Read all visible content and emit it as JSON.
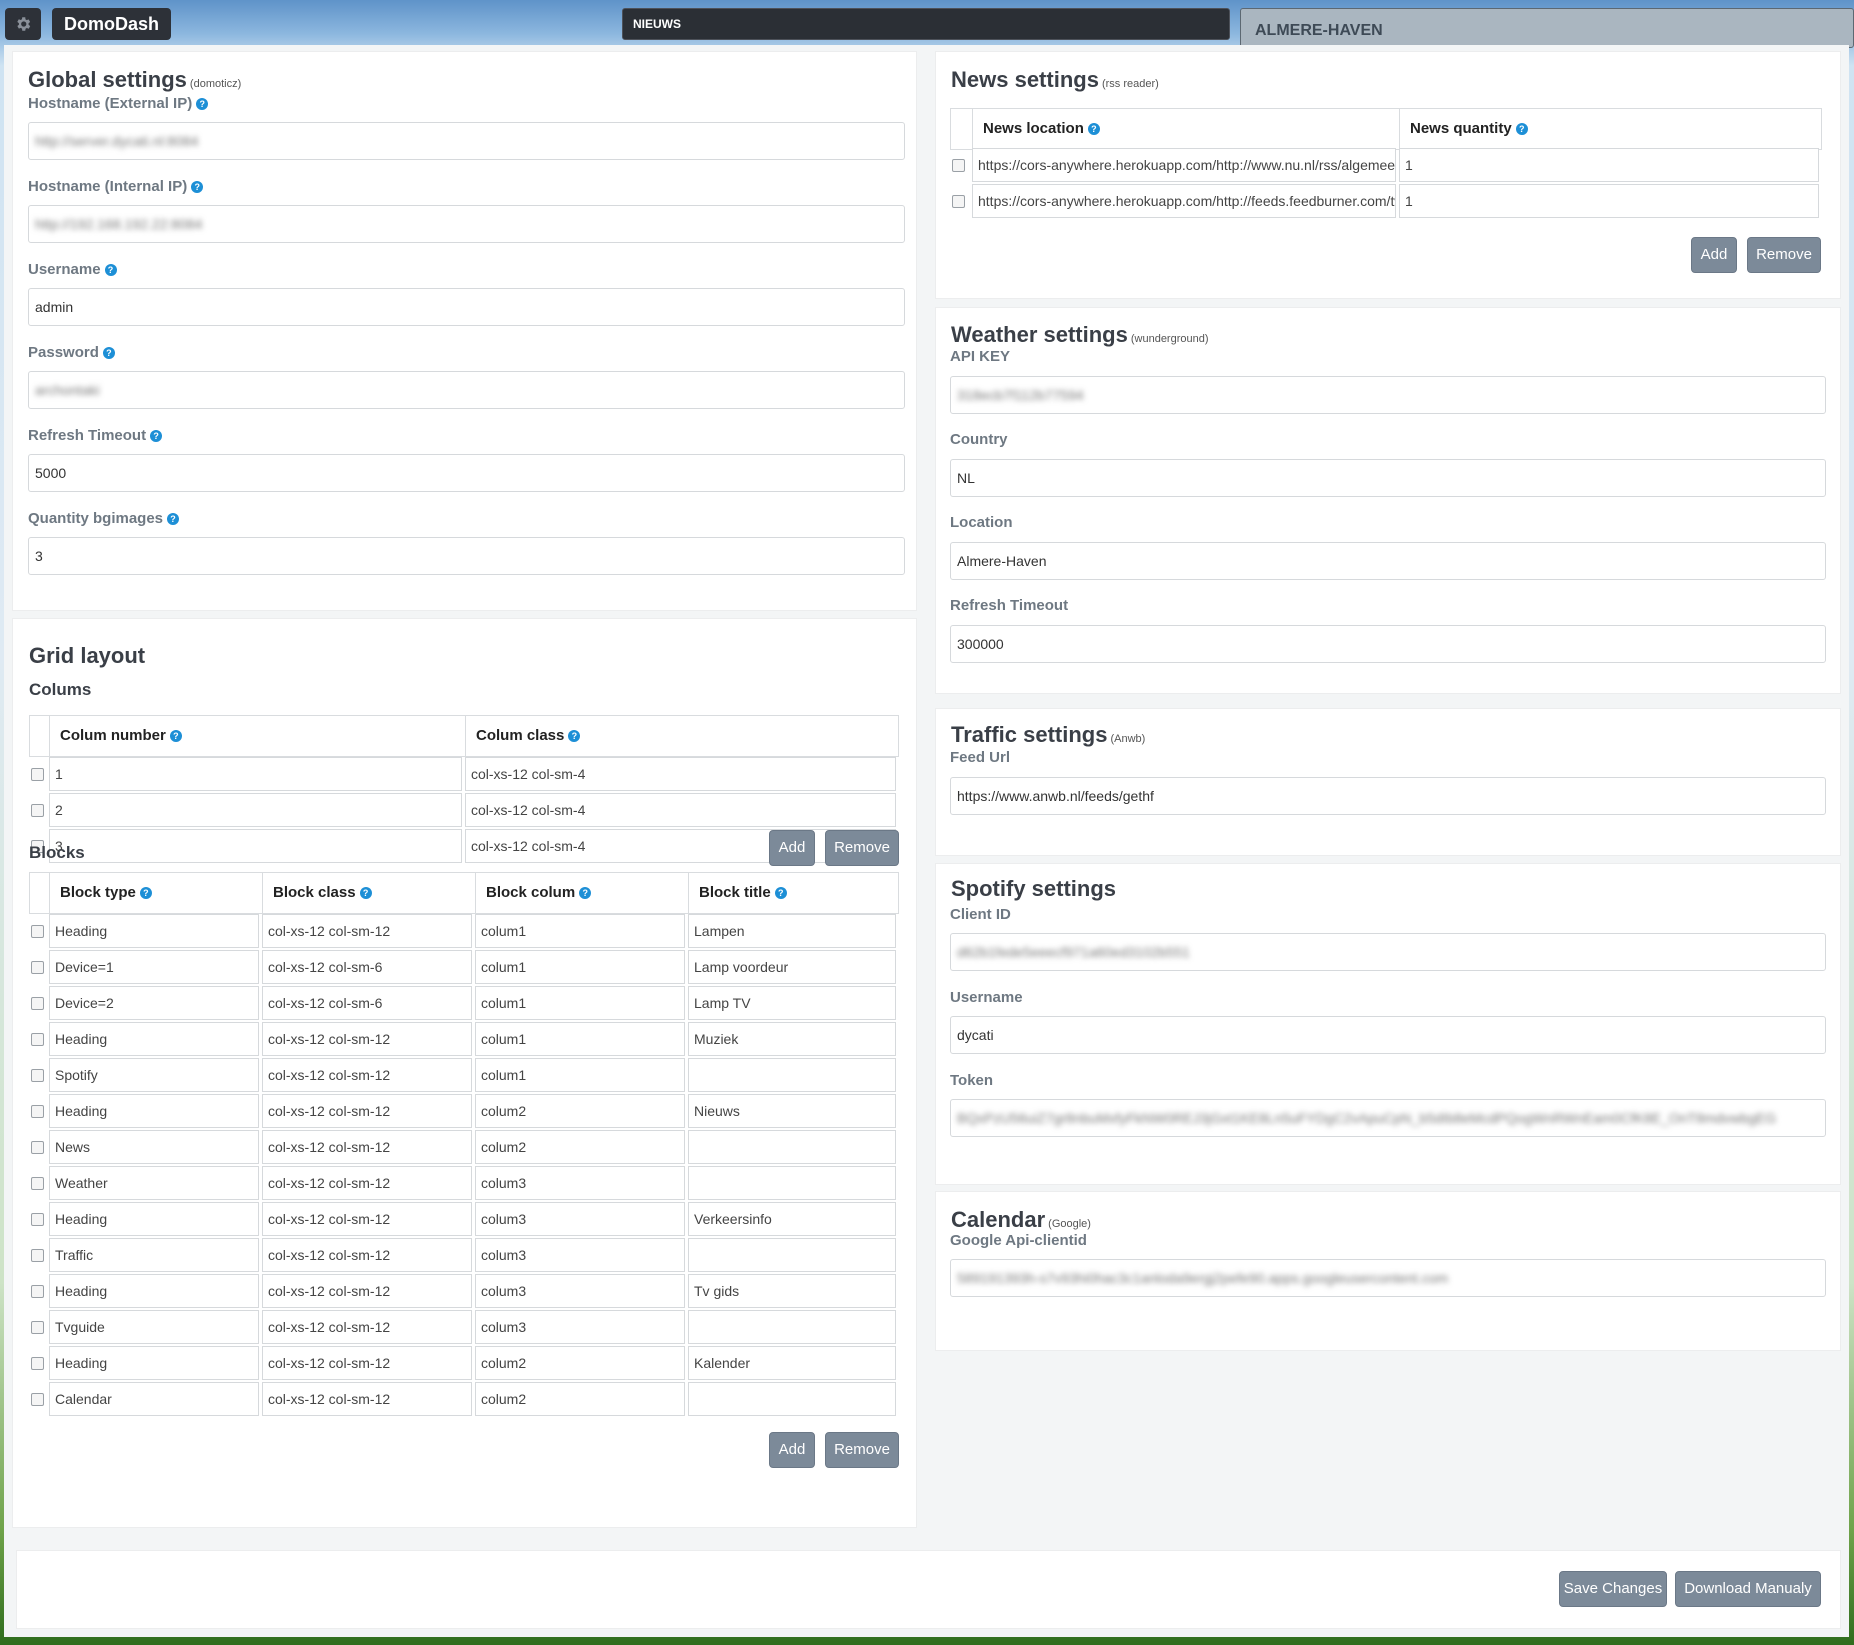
{
  "topbar": {
    "brand": "DomoDash",
    "news_label": "NIEUWS",
    "location": "ALMERE-HAVEN"
  },
  "global": {
    "title": "Global settings",
    "subtitle": "(domoticz)",
    "fields": [
      {
        "label": "Hostname (External IP)",
        "value": "http://server.dycati.nl:8084",
        "blurred": true
      },
      {
        "label": "Hostname (Internal IP)",
        "value": "http://192.168.192.22:8084",
        "blurred": true
      },
      {
        "label": "Username",
        "value": "admin"
      },
      {
        "label": "Password",
        "value": "archontaki",
        "blurred": true
      },
      {
        "label": "Refresh Timeout",
        "value": "5000"
      },
      {
        "label": "Quantity bgimages",
        "value": "3"
      }
    ]
  },
  "grid": {
    "title": "Grid layout",
    "colums_label": "Colums",
    "col_headers": [
      "Colum number",
      "Colum class"
    ],
    "columns": [
      [
        "1",
        "col-xs-12 col-sm-4"
      ],
      [
        "2",
        "col-xs-12 col-sm-4"
      ],
      [
        "3",
        "col-xs-12 col-sm-4"
      ]
    ],
    "blocks_label": "Blocks",
    "block_headers": [
      "Block type",
      "Block class",
      "Block colum",
      "Block title"
    ],
    "blocks": [
      [
        "Heading",
        "col-xs-12 col-sm-12",
        "colum1",
        "Lampen"
      ],
      [
        "Device=1",
        "col-xs-12 col-sm-6",
        "colum1",
        "Lamp voordeur"
      ],
      [
        "Device=2",
        "col-xs-12 col-sm-6",
        "colum1",
        "Lamp TV"
      ],
      [
        "Heading",
        "col-xs-12 col-sm-12",
        "colum1",
        "Muziek"
      ],
      [
        "Spotify",
        "col-xs-12 col-sm-12",
        "colum1",
        ""
      ],
      [
        "Heading",
        "col-xs-12 col-sm-12",
        "colum2",
        "Nieuws"
      ],
      [
        "News",
        "col-xs-12 col-sm-12",
        "colum2",
        ""
      ],
      [
        "Weather",
        "col-xs-12 col-sm-12",
        "colum3",
        ""
      ],
      [
        "Heading",
        "col-xs-12 col-sm-12",
        "colum3",
        "Verkeersinfo"
      ],
      [
        "Traffic",
        "col-xs-12 col-sm-12",
        "colum3",
        ""
      ],
      [
        "Heading",
        "col-xs-12 col-sm-12",
        "colum3",
        "Tv gids"
      ],
      [
        "Tvguide",
        "col-xs-12 col-sm-12",
        "colum3",
        ""
      ],
      [
        "Heading",
        "col-xs-12 col-sm-12",
        "colum2",
        "Kalender"
      ],
      [
        "Calendar",
        "col-xs-12 col-sm-12",
        "colum2",
        ""
      ]
    ]
  },
  "buttons": {
    "add": "Add",
    "remove": "Remove",
    "save": "Save Changes",
    "download": "Download Manualy"
  },
  "news": {
    "title": "News settings",
    "subtitle": "(rss reader)",
    "headers": [
      "News location",
      "News quantity"
    ],
    "rows": [
      [
        "https://cors-anywhere.herokuapp.com/http://www.nu.nl/rss/algemeen",
        "1"
      ],
      [
        "https://cors-anywhere.herokuapp.com/http://feeds.feedburner.com/tweakers",
        "1"
      ]
    ]
  },
  "weather": {
    "title": "Weather settings",
    "subtitle": "(wunderground)",
    "fields": [
      {
        "label": "API KEY",
        "value": "318ecb7f112b77594",
        "blurred": true
      },
      {
        "label": "Country",
        "value": "NL"
      },
      {
        "label": "Location",
        "value": "Almere-Haven"
      },
      {
        "label": "Refresh Timeout",
        "value": "300000"
      }
    ]
  },
  "traffic": {
    "title": "Traffic settings",
    "subtitle": "(Anwb)",
    "fields": [
      {
        "label": "Feed Url",
        "value": "https://www.anwb.nl/feeds/gethf"
      }
    ]
  },
  "spotify": {
    "title": "Spotify settings",
    "subtitle": "",
    "fields": [
      {
        "label": "Client ID",
        "value": "d62b1fede5eeecf971a60ed3102b551",
        "blurred": true
      },
      {
        "label": "Username",
        "value": "dycati"
      },
      {
        "label": "Token",
        "value": "BQxPzU56uiZ7gr8nbuMxfyFkNW0REJ3jGxt1KE8Ln5uFYDgC2vApuCpN_b5dIb8eMcdPQogWnRWnEam0CfK8E_OnT8mdvwbgEG",
        "blurred": true
      }
    ]
  },
  "calendar": {
    "title": "Calendar",
    "subtitle": "(Google)",
    "fields": [
      {
        "label": "Google Api-clientid",
        "value": "589191393h-s7v93hi0hac3c1anloda9ergj2pefe90.apps.googleusercontent.com",
        "blurred": true
      }
    ]
  }
}
